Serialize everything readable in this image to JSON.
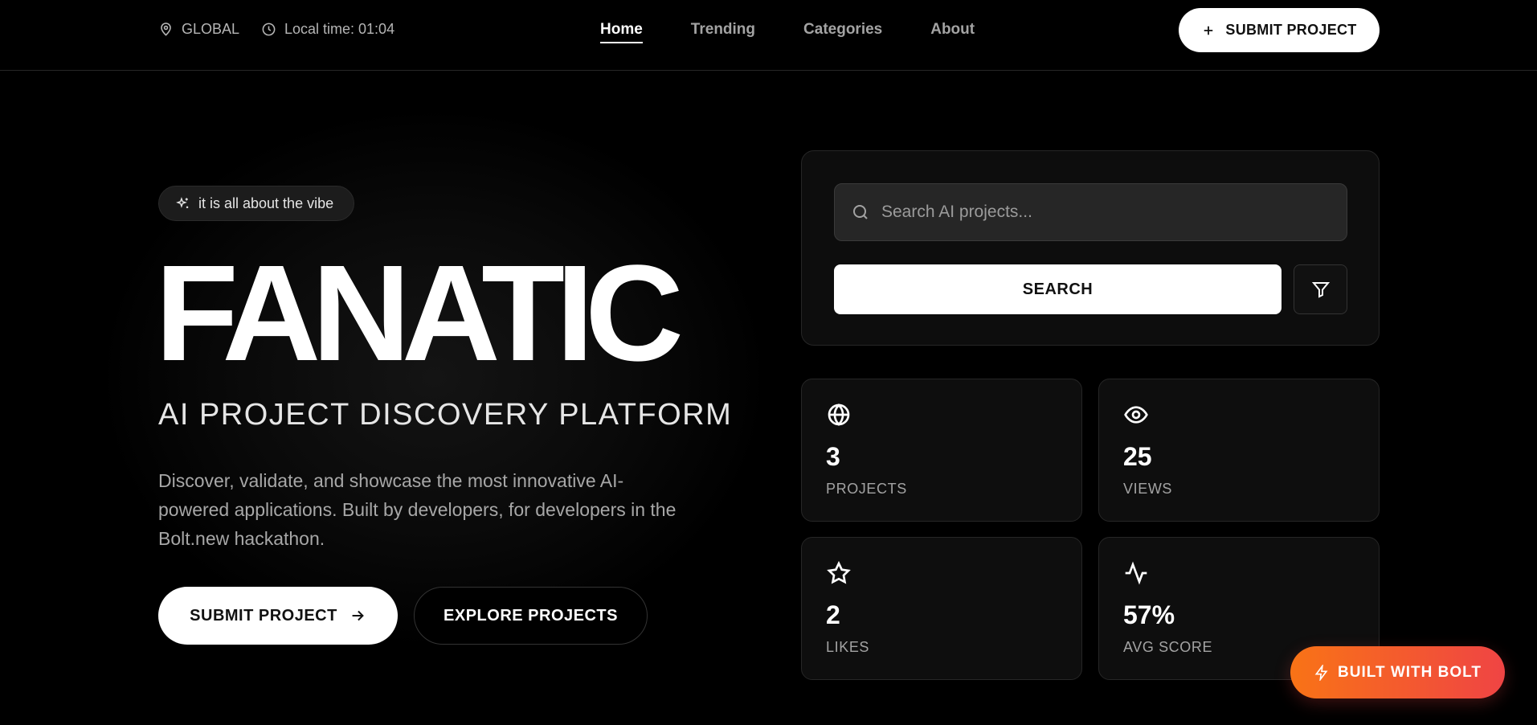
{
  "header": {
    "location": "GLOBAL",
    "local_time": "Local time: 01:04",
    "nav": [
      {
        "label": "Home",
        "active": true
      },
      {
        "label": "Trending",
        "active": false
      },
      {
        "label": "Categories",
        "active": false
      },
      {
        "label": "About",
        "active": false
      }
    ],
    "submit_label": "SUBMIT PROJECT",
    "icons": {
      "location": "map-pin-icon",
      "time": "clock-icon",
      "submit": "plus-icon"
    }
  },
  "hero": {
    "pill": "it is all about the vibe",
    "pill_icon": "sparkles-icon",
    "brand": "FANATIC",
    "tagline": "AI PROJECT DISCOVERY PLATFORM",
    "description": "Discover, validate, and showcase the most innovative AI-powered applications. Built by developers, for developers in the Bolt.new hackathon.",
    "primary_button": "SUBMIT PROJECT",
    "secondary_button": "EXPLORE PROJECTS"
  },
  "search": {
    "placeholder": "Search AI projects...",
    "value": "",
    "button": "SEARCH",
    "filter_icon": "filter-icon"
  },
  "stats": [
    {
      "icon": "globe-icon",
      "value": "3",
      "label": "PROJECTS"
    },
    {
      "icon": "eye-icon",
      "value": "25",
      "label": "VIEWS"
    },
    {
      "icon": "star-icon",
      "value": "2",
      "label": "LIKES"
    },
    {
      "icon": "activity-icon",
      "value": "57%",
      "label": "AVG SCORE"
    }
  ],
  "badge": {
    "label": "BUILT WITH BOLT",
    "icon": "zap-icon"
  },
  "colors": {
    "background": "#000000",
    "badge_gradient_start": "#f97316",
    "badge_gradient_end": "#ef4444"
  }
}
